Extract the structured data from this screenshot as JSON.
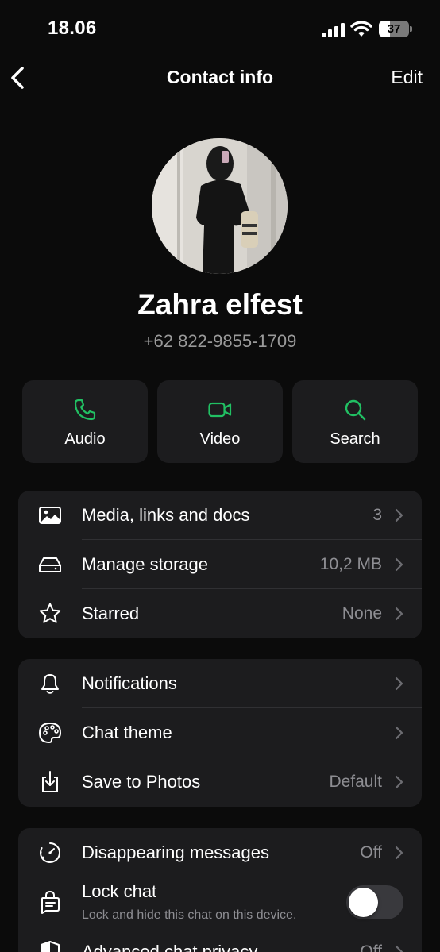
{
  "status_bar": {
    "time": "18.06",
    "battery_level": "37",
    "battery_fraction": 0.37
  },
  "nav": {
    "title": "Contact info",
    "edit_label": "Edit"
  },
  "contact": {
    "name": "Zahra elfest",
    "phone": "+62 822-9855-1709"
  },
  "actions": [
    {
      "label": "Audio",
      "icon": "phone-icon"
    },
    {
      "label": "Video",
      "icon": "video-camera-icon"
    },
    {
      "label": "Search",
      "icon": "search-icon"
    }
  ],
  "group1": [
    {
      "label": "Media, links and docs",
      "value": "3",
      "icon": "image-icon"
    },
    {
      "label": "Manage storage",
      "value": "10,2 MB",
      "icon": "storage-icon"
    },
    {
      "label": "Starred",
      "value": "None",
      "icon": "star-icon"
    }
  ],
  "group2": [
    {
      "label": "Notifications",
      "value": "",
      "icon": "bell-icon"
    },
    {
      "label": "Chat theme",
      "value": "",
      "icon": "palette-icon"
    },
    {
      "label": "Save to Photos",
      "value": "Default",
      "icon": "download-icon"
    }
  ],
  "group3": {
    "disappearing": {
      "label": "Disappearing messages",
      "value": "Off",
      "icon": "timer-icon"
    },
    "lock_chat": {
      "label": "Lock chat",
      "subtitle": "Lock and hide this chat on this device.",
      "enabled": false,
      "icon": "lock-chat-icon"
    },
    "advanced_privacy": {
      "label": "Advanced chat privacy",
      "value": "Off",
      "icon": "shield-icon"
    }
  },
  "colors": {
    "accent": "#21c063",
    "background": "#0b0b0b",
    "card": "#1c1c1e",
    "secondary_text": "#8e8e93"
  }
}
